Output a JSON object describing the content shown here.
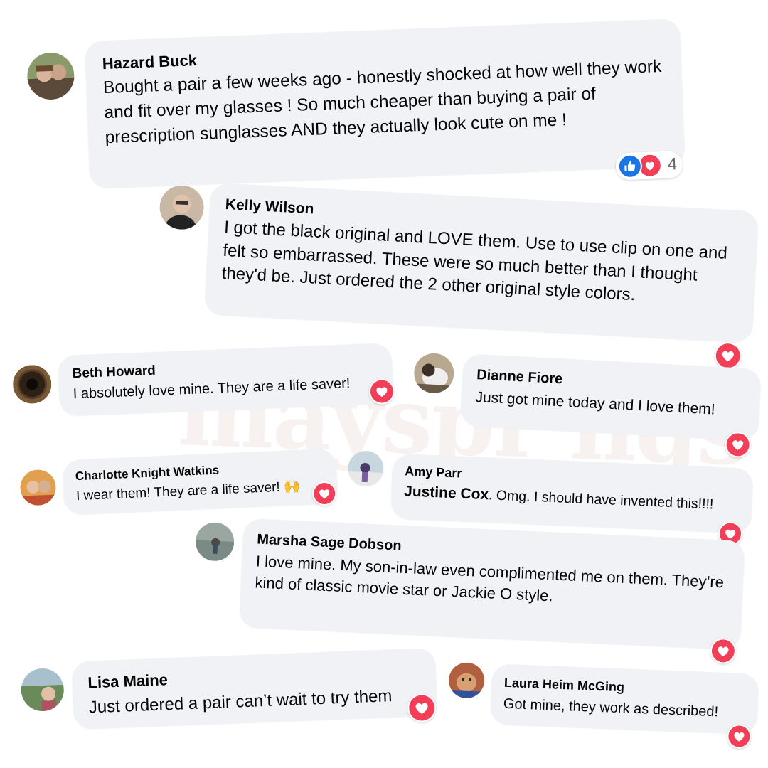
{
  "watermark": "mayspr ngs",
  "colors": {
    "bubble": "#f0f2f5",
    "heart": "#f33e58",
    "like": "#1b74e4",
    "count": "#65676b"
  },
  "reaction_icons": [
    "like-icon",
    "heart-icon"
  ],
  "comments": [
    {
      "author": "Hazard Buck",
      "text": "Bought a pair a few weeks ago - honestly shocked at how well they work and fit over my glasses ! So much cheaper than buying a pair of prescription sunglasses AND they actually look cute on me !",
      "reaction_count": "4"
    },
    {
      "author": "Kelly Wilson",
      "text": "I got the black original and LOVE them. Use to use clip on one and felt so embarrassed. These were so much better than I thought they'd be. Just ordered the 2 other original style colors."
    },
    {
      "author": "Beth Howard",
      "text": "I absolutely love mine. They are a life saver!"
    },
    {
      "author": "Dianne Fiore",
      "text": "Just got mine today and I love them!"
    },
    {
      "author": "Charlotte Knight Watkins",
      "text": "I wear them! They are a life saver!",
      "emoji": "🙌"
    },
    {
      "author": "Amy Parr",
      "tag": "Justine Cox",
      "text": ". Omg. I should have invented this!!!!"
    },
    {
      "author": "Marsha Sage Dobson",
      "text": "I love mine. My son-in-law even complimented me on them. They’re kind of classic movie star or Jackie O style."
    },
    {
      "author": "Lisa Maine",
      "text": "Just ordered a pair can’t wait to try them"
    },
    {
      "author": "Laura Heim McGing",
      "text": "Got mine, they work as described!"
    }
  ]
}
